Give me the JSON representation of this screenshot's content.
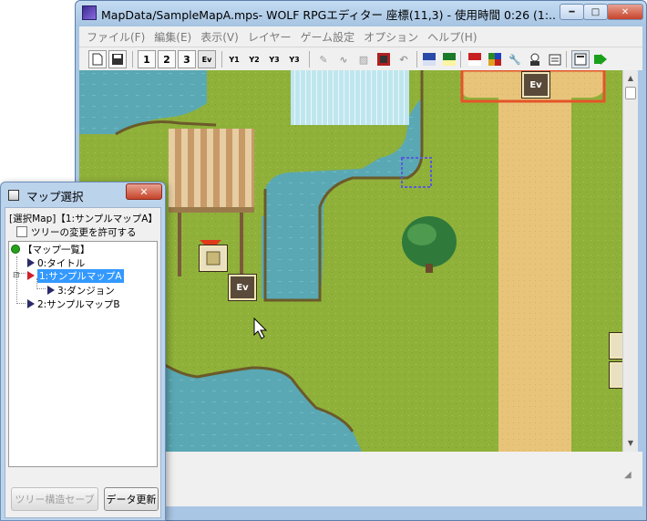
{
  "main_window": {
    "title": "MapData/SampleMapA.mps- WOLF RPGエディター 座標(11,3) - 使用時間 0:26 (1:...",
    "buttons": {
      "minimize": "━",
      "maximize": "□",
      "close": "✕"
    }
  },
  "menu": {
    "items": [
      "ファイル(F)",
      "編集(E)",
      "表示(V)",
      "レイヤー",
      "ゲーム設定",
      "オプション",
      "ヘルプ(H)"
    ]
  },
  "toolbar": {
    "layer_buttons": [
      "1",
      "2",
      "3"
    ],
    "ev_label": "Ev",
    "layer_edit_buttons": [
      "Y1",
      "Y2",
      "Y3",
      "Y3"
    ]
  },
  "map": {
    "event_label": "Ev"
  },
  "map_select": {
    "title": "マップ選択",
    "close": "✕",
    "selected_label": "[選択Map]【1:サンプルマップA】",
    "allow_tree_change": "ツリーの変更を許可する",
    "tree": {
      "root": "【マップ一覧】",
      "items": [
        "0:タイトル",
        "1:サンプルマップA",
        "3:ダンジョン",
        "2:サンプルマップB"
      ]
    },
    "save_tree_button": "ツリー構造セーブ",
    "refresh_button": "データ更新"
  },
  "colors": {
    "grass": "#8fb13a",
    "water": "#5aa8b4",
    "path": "#e8c47a",
    "selection": "#3399ff",
    "highlight_box": "#e4542a"
  }
}
